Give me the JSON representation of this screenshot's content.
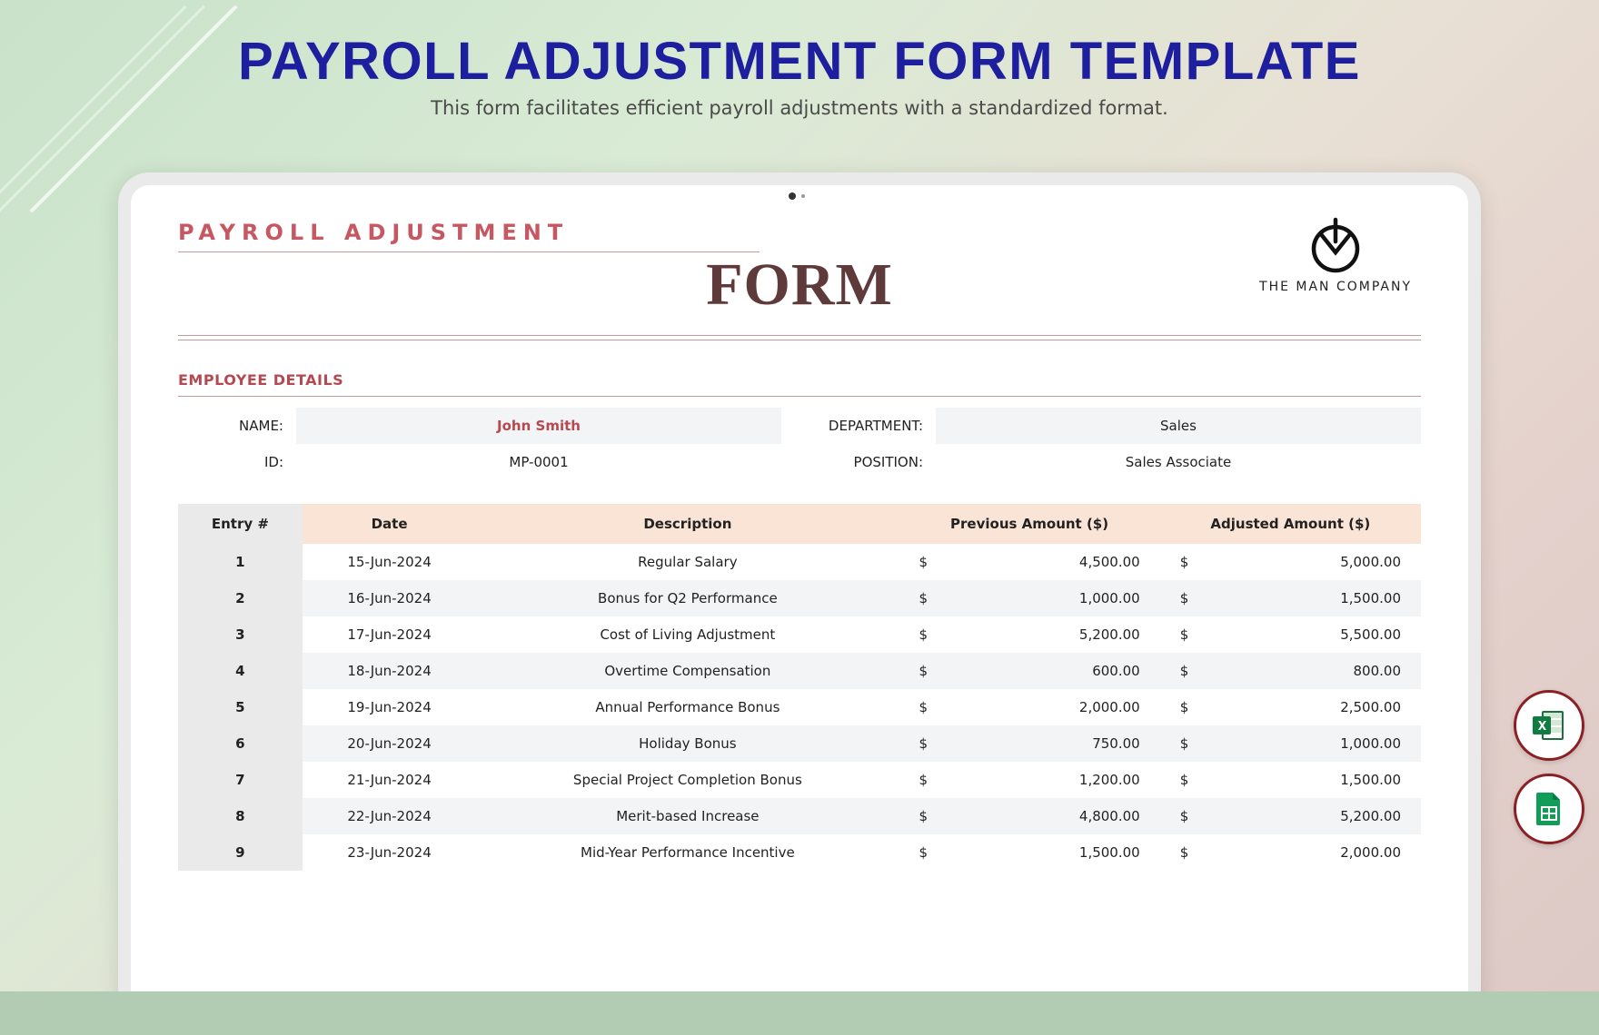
{
  "header": {
    "title": "PAYROLL ADJUSTMENT FORM TEMPLATE",
    "subtitle": "This form facilitates efficient payroll adjustments with a standardized format."
  },
  "doc": {
    "smallTitle": "PAYROLL ADJUSTMENT",
    "bigTitle": "FORM",
    "company": "THE MAN COMPANY",
    "section": "EMPLOYEE DETAILS",
    "labels": {
      "name": "NAME:",
      "id": "ID:",
      "dept": "DEPARTMENT:",
      "pos": "POSITION:"
    },
    "employee": {
      "name": "John Smith",
      "id": "MP-0001",
      "department": "Sales",
      "position": "Sales Associate"
    },
    "columns": [
      "Entry #",
      "Date",
      "Description",
      "Previous Amount ($)",
      "Adjusted Amount ($)"
    ],
    "rows": [
      {
        "e": "1",
        "date": "15-Jun-2024",
        "desc": "Regular Salary",
        "prev": "4,500.00",
        "adj": "5,000.00"
      },
      {
        "e": "2",
        "date": "16-Jun-2024",
        "desc": "Bonus for Q2 Performance",
        "prev": "1,000.00",
        "adj": "1,500.00"
      },
      {
        "e": "3",
        "date": "17-Jun-2024",
        "desc": "Cost of Living Adjustment",
        "prev": "5,200.00",
        "adj": "5,500.00"
      },
      {
        "e": "4",
        "date": "18-Jun-2024",
        "desc": "Overtime Compensation",
        "prev": "600.00",
        "adj": "800.00"
      },
      {
        "e": "5",
        "date": "19-Jun-2024",
        "desc": "Annual Performance Bonus",
        "prev": "2,000.00",
        "adj": "2,500.00"
      },
      {
        "e": "6",
        "date": "20-Jun-2024",
        "desc": "Holiday Bonus",
        "prev": "750.00",
        "adj": "1,000.00"
      },
      {
        "e": "7",
        "date": "21-Jun-2024",
        "desc": "Special Project Completion Bonus",
        "prev": "1,200.00",
        "adj": "1,500.00"
      },
      {
        "e": "8",
        "date": "22-Jun-2024",
        "desc": "Merit-based Increase",
        "prev": "4,800.00",
        "adj": "5,200.00"
      },
      {
        "e": "9",
        "date": "23-Jun-2024",
        "desc": "Mid-Year Performance Incentive",
        "prev": "1,500.00",
        "adj": "2,000.00"
      }
    ],
    "currency": "$"
  },
  "chart_data": {
    "type": "table",
    "title": "Payroll Adjustment Entries",
    "columns": [
      "Entry #",
      "Date",
      "Description",
      "Previous Amount ($)",
      "Adjusted Amount ($)"
    ],
    "rows": [
      [
        1,
        "15-Jun-2024",
        "Regular Salary",
        4500.0,
        5000.0
      ],
      [
        2,
        "16-Jun-2024",
        "Bonus for Q2 Performance",
        1000.0,
        1500.0
      ],
      [
        3,
        "17-Jun-2024",
        "Cost of Living Adjustment",
        5200.0,
        5500.0
      ],
      [
        4,
        "18-Jun-2024",
        "Overtime Compensation",
        600.0,
        800.0
      ],
      [
        5,
        "19-Jun-2024",
        "Annual Performance Bonus",
        2000.0,
        2500.0
      ],
      [
        6,
        "20-Jun-2024",
        "Holiday Bonus",
        750.0,
        1000.0
      ],
      [
        7,
        "21-Jun-2024",
        "Special Project Completion Bonus",
        1200.0,
        1500.0
      ],
      [
        8,
        "22-Jun-2024",
        "Merit-based Increase",
        4800.0,
        5200.0
      ],
      [
        9,
        "23-Jun-2024",
        "Mid-Year Performance Incentive",
        1500.0,
        2000.0
      ]
    ]
  }
}
